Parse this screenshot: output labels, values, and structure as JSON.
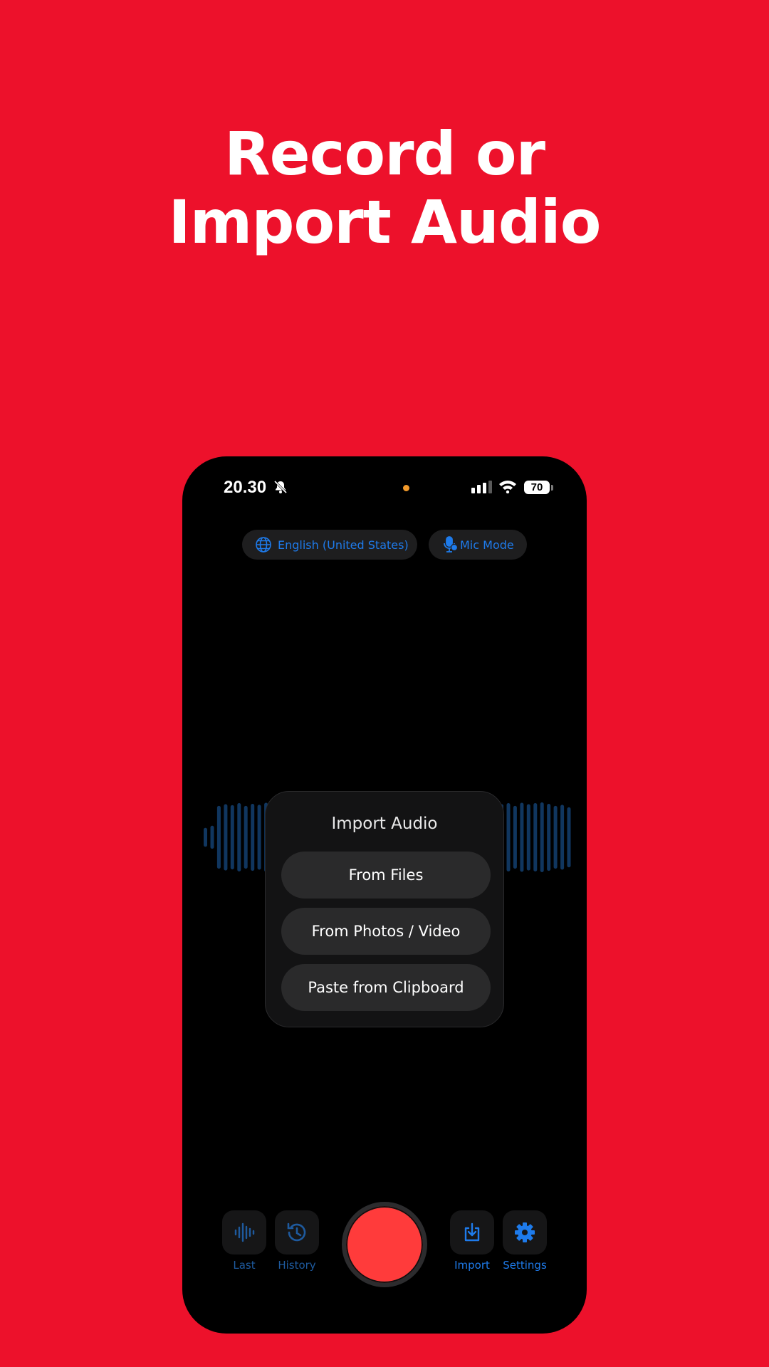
{
  "headline": {
    "line1": "Record or",
    "line2": "Import Audio"
  },
  "status_bar": {
    "time": "20.30",
    "battery": "70"
  },
  "top_controls": {
    "language": "English (United States)",
    "mic_mode": "Mic Mode"
  },
  "import_dialog": {
    "title": "Import Audio",
    "options": [
      "From Files",
      "From Photos / Video",
      "Paste from Clipboard"
    ]
  },
  "bottom_bar": {
    "last": "Last",
    "history": "History",
    "import": "Import",
    "settings": "Settings"
  },
  "colors": {
    "background": "#ED112B",
    "accent": "#1E7BEB",
    "record": "#FF3B3B"
  },
  "waveform_levels": [
    0.27,
    0.33,
    0.9,
    0.95,
    0.92,
    0.98,
    0.9,
    0.96,
    0.93,
    0.99,
    0.88,
    0.95,
    0.9,
    0.86,
    0.92,
    0.88,
    0.8,
    0.85,
    0.75,
    0.8,
    0.7,
    0.72,
    0.65,
    0.6,
    0.55,
    0.5,
    0.45,
    0.4,
    0.35,
    0.3,
    0.3,
    0.35,
    0.4,
    0.5,
    0.55,
    0.6,
    0.65,
    0.7,
    0.75,
    0.8,
    0.85,
    0.88,
    0.9,
    0.93,
    0.95,
    0.98,
    0.9,
    0.99,
    0.95,
    0.98,
    1.0,
    0.96,
    0.9,
    0.93,
    0.86
  ]
}
